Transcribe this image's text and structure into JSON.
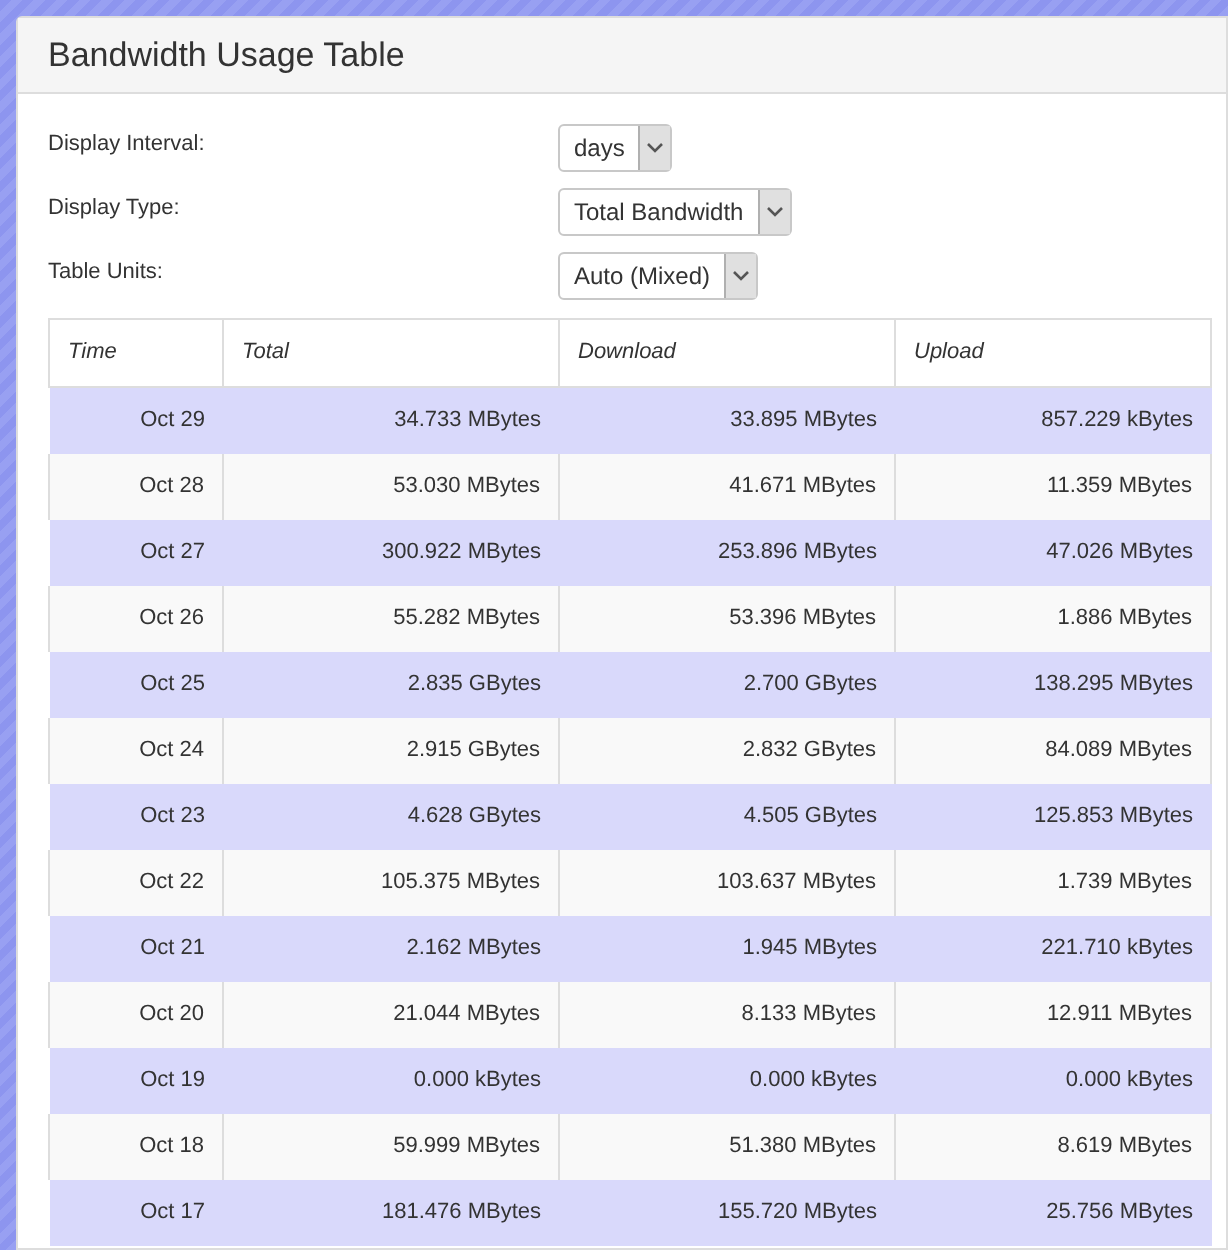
{
  "panel": {
    "title": "Bandwidth Usage Table"
  },
  "settings": [
    {
      "label": "Display Interval:",
      "value": "days"
    },
    {
      "label": "Display Type:",
      "value": "Total Bandwidth"
    },
    {
      "label": "Table Units:",
      "value": "Auto (Mixed)"
    }
  ],
  "table": {
    "columns": [
      "Time",
      "Total",
      "Download",
      "Upload"
    ],
    "rows": [
      [
        "Oct 29",
        "34.733 MBytes",
        "33.895 MBytes",
        "857.229 kBytes"
      ],
      [
        "Oct 28",
        "53.030 MBytes",
        "41.671 MBytes",
        "11.359 MBytes"
      ],
      [
        "Oct 27",
        "300.922 MBytes",
        "253.896 MBytes",
        "47.026 MBytes"
      ],
      [
        "Oct 26",
        "55.282 MBytes",
        "53.396 MBytes",
        "1.886 MBytes"
      ],
      [
        "Oct 25",
        "2.835 GBytes",
        "2.700 GBytes",
        "138.295 MBytes"
      ],
      [
        "Oct 24",
        "2.915 GBytes",
        "2.832 GBytes",
        "84.089 MBytes"
      ],
      [
        "Oct 23",
        "4.628 GBytes",
        "4.505 GBytes",
        "125.853 MBytes"
      ],
      [
        "Oct 22",
        "105.375 MBytes",
        "103.637 MBytes",
        "1.739 MBytes"
      ],
      [
        "Oct 21",
        "2.162 MBytes",
        "1.945 MBytes",
        "221.710 kBytes"
      ],
      [
        "Oct 20",
        "21.044 MBytes",
        "8.133 MBytes",
        "12.911 MBytes"
      ],
      [
        "Oct 19",
        "0.000 kBytes",
        "0.000 kBytes",
        "0.000 kBytes"
      ],
      [
        "Oct 18",
        "59.999 MBytes",
        "51.380 MBytes",
        "8.619 MBytes"
      ],
      [
        "Oct 17",
        "181.476 MBytes",
        "155.720 MBytes",
        "25.756 MBytes"
      ]
    ]
  }
}
